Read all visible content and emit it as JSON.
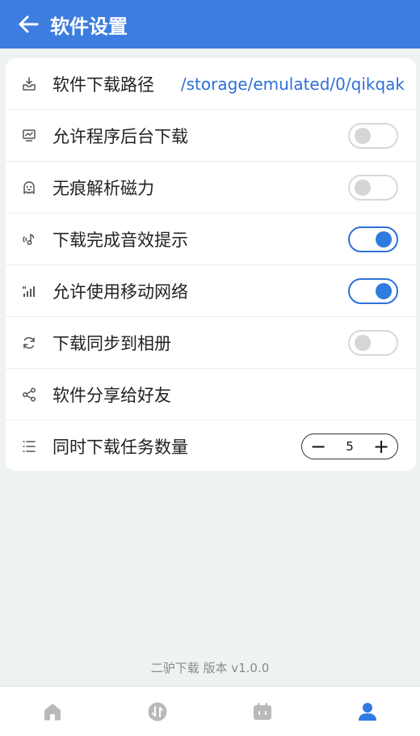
{
  "header": {
    "title": "软件设置",
    "back_icon": "arrow-left-icon"
  },
  "settings": {
    "download_path": {
      "label": "软件下载路径",
      "value": "/storage/emulated/0/qikqak",
      "icon": "download-tray-icon"
    },
    "background_download": {
      "label": "允许程序后台下载",
      "enabled": false,
      "icon": "monitor-chart-icon"
    },
    "incognito_magnet": {
      "label": "无痕解析磁力",
      "enabled": false,
      "icon": "ghost-icon"
    },
    "complete_sound": {
      "label": "下载完成音效提示",
      "enabled": true,
      "icon": "sound-wave-icon"
    },
    "mobile_network": {
      "label": "允许使用移动网络",
      "enabled": true,
      "icon": "signal-bars-icon"
    },
    "sync_album": {
      "label": "下载同步到相册",
      "enabled": false,
      "icon": "sync-icon"
    },
    "share_app": {
      "label": "软件分享给好友",
      "icon": "share-icon"
    },
    "concurrent_tasks": {
      "label": "同时下载任务数量",
      "value": "5",
      "minus": "−",
      "plus": "+",
      "icon": "list-icon"
    }
  },
  "footer": {
    "version": "二驴下载 版本 v1.0.0"
  },
  "tabbar": {
    "items": [
      {
        "icon": "home-icon",
        "active": false
      },
      {
        "icon": "transfer-icon",
        "active": false
      },
      {
        "icon": "calendar-icon",
        "active": false
      },
      {
        "icon": "user-icon",
        "active": true
      }
    ]
  },
  "colors": {
    "accent": "#3d7ddf",
    "toggle_on": "#2e7ce0",
    "background": "#eef2f3",
    "tab_inactive": "#b9b9b9"
  }
}
